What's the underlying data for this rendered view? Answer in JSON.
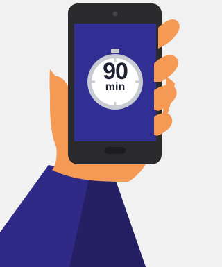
{
  "timer": {
    "value": "90",
    "unit": "min",
    "icon": "stopwatch-icon"
  },
  "illustration": {
    "subject": "hand-holding-phone",
    "colors": {
      "background": "#f1f1f2",
      "sleeve": "#2f2a86",
      "sleeve_shadow": "#252063",
      "skin": "#f59a55",
      "phone_body": "#2a2a2c",
      "screen": "#312f93",
      "timer_face": "#ffffff",
      "timer_ring": "#c9cbd3",
      "text": "#1e2230"
    }
  }
}
